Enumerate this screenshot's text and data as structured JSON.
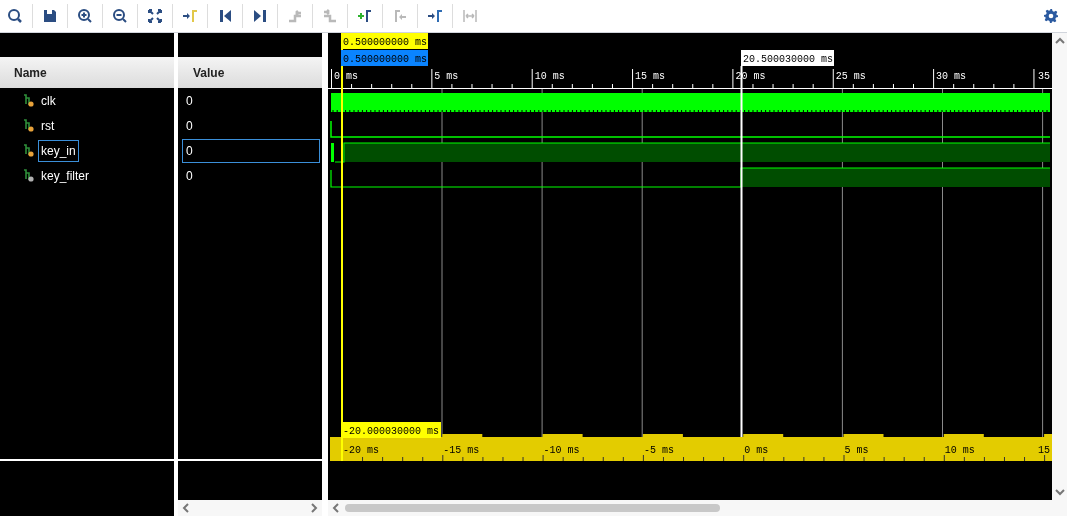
{
  "toolbar": [
    {
      "kind": "search",
      "disabled": false
    },
    {
      "kind": "save",
      "disabled": false
    },
    {
      "kind": "zoom_in",
      "disabled": false
    },
    {
      "kind": "zoom_out",
      "disabled": false
    },
    {
      "kind": "fit",
      "disabled": false
    },
    {
      "kind": "goto_cursor",
      "disabled": false
    },
    {
      "kind": "goto_start",
      "disabled": false
    },
    {
      "kind": "goto_end",
      "disabled": false
    },
    {
      "kind": "swap_up",
      "disabled": true
    },
    {
      "kind": "swap_down",
      "disabled": true
    },
    {
      "kind": "add_marker",
      "disabled": false
    },
    {
      "kind": "prev_marker",
      "disabled": true
    },
    {
      "kind": "next_marker",
      "disabled": false
    },
    {
      "kind": "distance",
      "disabled": true
    }
  ],
  "columns": {
    "name": "Name",
    "value": "Value"
  },
  "signals": [
    {
      "name": "clk",
      "value": "0",
      "selected": false,
      "kind": "clock"
    },
    {
      "name": "rst",
      "value": "0",
      "selected": false,
      "kind": "reset_blip"
    },
    {
      "name": "key_in",
      "value": "0",
      "selected": true,
      "kind": "bouncing_high"
    },
    {
      "name": "key_filter",
      "value": "0",
      "selected": false,
      "kind": "late_high"
    }
  ],
  "cursors": {
    "main": "0.500000000 ms",
    "main_marker": "0.500000000 ms",
    "second": "20.500030000 ms",
    "delta": "-20.000030000 ms"
  },
  "top_ruler": [
    "0 ms",
    "5 ms",
    "10 ms",
    "15 ms",
    "20 ms",
    "25 ms",
    "30 ms",
    "35"
  ],
  "bottom_ruler": [
    "-20 ms",
    "-15 ms",
    "-10 ms",
    "-5 ms",
    "0 ms",
    "5 ms",
    "10 ms",
    "15"
  ]
}
